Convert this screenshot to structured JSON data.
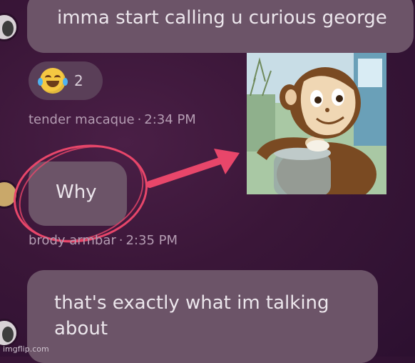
{
  "messages": [
    {
      "text": "imma start calling u curious george"
    },
    {
      "reaction": {
        "emoji": "laughing-crying",
        "count": "2"
      }
    },
    {
      "sender": "tender macaque",
      "time": "2:34 PM"
    },
    {
      "text": "Why"
    },
    {
      "sender": "brody armbar",
      "time": "2:35 PM"
    },
    {
      "text": "that's exactly what im talking about"
    }
  ],
  "annotations": {
    "circle_color": "#e8466a",
    "arrow_color": "#e8466a"
  },
  "image_content": "curious-george-illustration",
  "watermark": "imgflip.com"
}
